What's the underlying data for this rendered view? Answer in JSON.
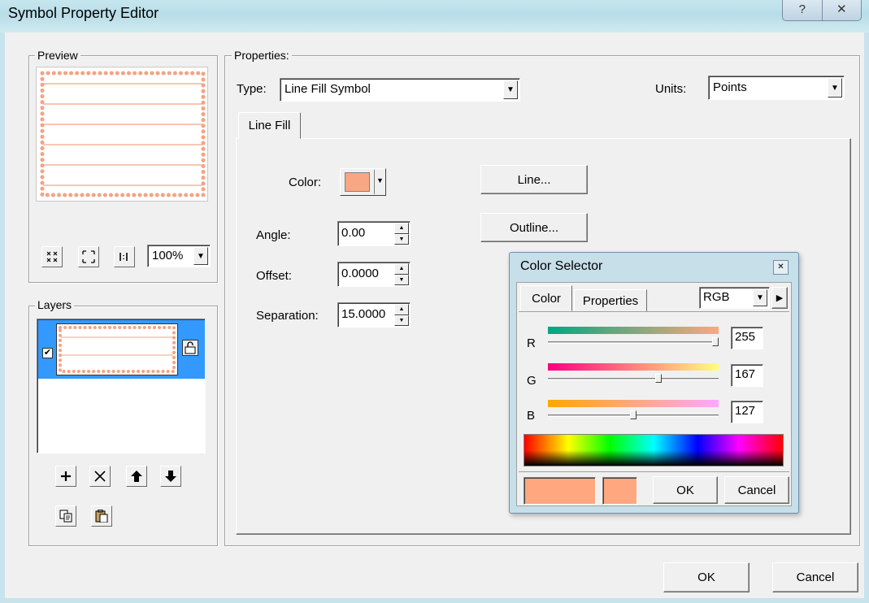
{
  "window": {
    "title": "Symbol Property Editor",
    "help_glyph": "?",
    "close_glyph": "✕"
  },
  "preview": {
    "legend": "Preview",
    "zoom": "100%",
    "fill_color": "#f4a384"
  },
  "layers": {
    "legend": "Layers",
    "checked": true
  },
  "properties": {
    "legend": "Properties:",
    "type_label": "Type:",
    "type_value": "Line Fill Symbol",
    "units_label": "Units:",
    "units_value": "Points",
    "tab": "Line Fill",
    "color_label": "Color:",
    "color_value": "#f9a783",
    "angle_label": "Angle:",
    "angle_value": "0.00",
    "offset_label": "Offset:",
    "offset_value": "0.0000",
    "separation_label": "Separation:",
    "separation_value": "15.0000",
    "line_button": "Line...",
    "outline_button": "Outline..."
  },
  "color_selector": {
    "title": "Color Selector",
    "tab_color": "Color",
    "tab_properties": "Properties",
    "model": "RGB",
    "r_label": "R",
    "r_value": "255",
    "r_level": 1.0,
    "g_label": "G",
    "g_value": "167",
    "g_level": 0.655,
    "b_label": "B",
    "b_value": "127",
    "b_level": 0.498,
    "swatch_color": "#ffa77f",
    "ok": "OK",
    "cancel": "Cancel"
  },
  "footer": {
    "ok": "OK",
    "cancel": "Cancel"
  }
}
